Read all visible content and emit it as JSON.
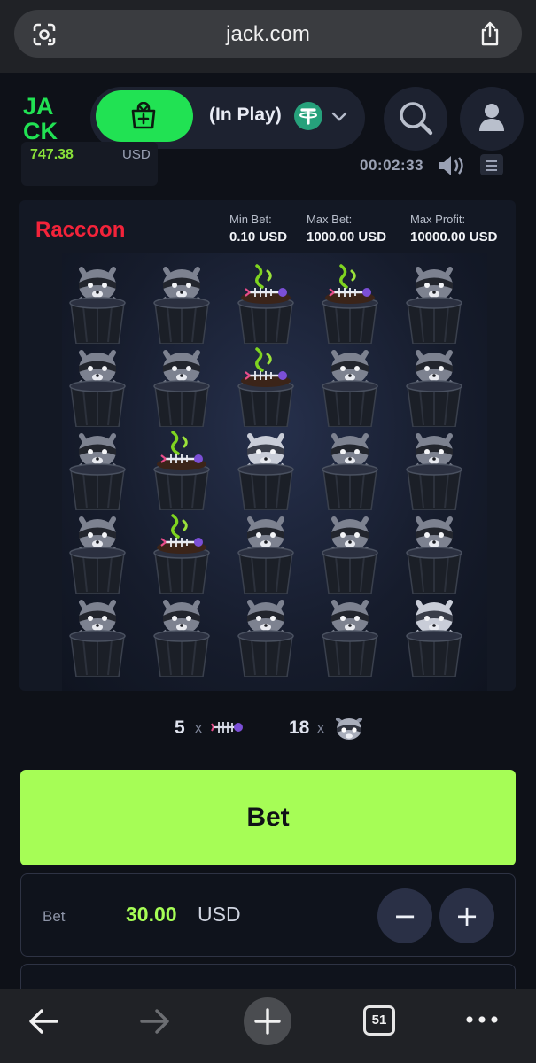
{
  "browser": {
    "url": "jack.com",
    "tabs_count": "51"
  },
  "header": {
    "logo_text": "JACK",
    "wallet_status": "(In Play)",
    "currency_icon": "tether-icon"
  },
  "top_strip": {
    "balance": "747.38",
    "balance_currency": "USD",
    "timer": "00:02:33"
  },
  "game": {
    "title": "Raccoon",
    "min_bet_label": "Min Bet:",
    "min_bet_value": "0.10 USD",
    "max_bet_label": "Max Bet:",
    "max_bet_value": "1000.00 USD",
    "max_profit_label": "Max Profit:",
    "max_profit_value": "10000.00 USD",
    "grid": [
      [
        "raccoon",
        "raccoon",
        "fish",
        "fish",
        "raccoon"
      ],
      [
        "raccoon",
        "raccoon",
        "fish",
        "raccoon",
        "raccoon"
      ],
      [
        "raccoon",
        "fish",
        "raccoon-highlighted",
        "raccoon",
        "raccoon"
      ],
      [
        "raccoon",
        "fish",
        "raccoon",
        "raccoon",
        "raccoon"
      ],
      [
        "raccoon",
        "raccoon",
        "raccoon",
        "raccoon",
        "raccoon-highlighted"
      ]
    ]
  },
  "summary": {
    "fish_count": "5",
    "raccoon_count": "18",
    "times": "x"
  },
  "bet": {
    "button_label": "Bet",
    "label": "Bet",
    "amount": "30.00",
    "currency": "USD",
    "minus": "−",
    "plus": "+"
  },
  "colors": {
    "accent_green": "#a6fd56",
    "cashier_green": "#21e253",
    "title_red": "#f3233a"
  }
}
